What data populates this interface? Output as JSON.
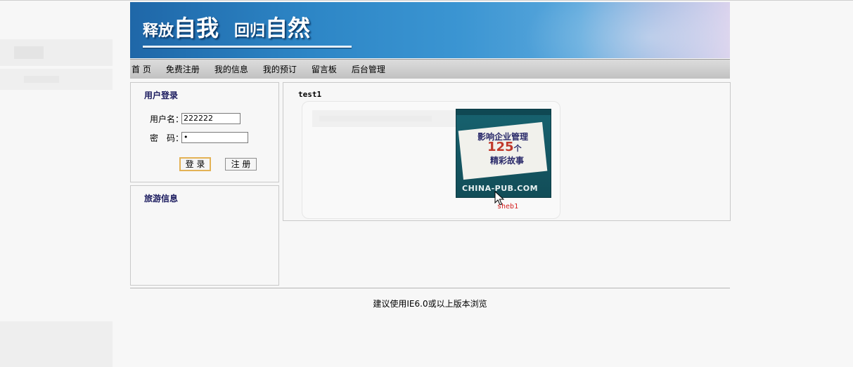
{
  "banner": {
    "title_part1_small": "释放",
    "title_part1_big": "自我",
    "title_part2_small": "回归",
    "title_part2_big": "自然"
  },
  "nav": {
    "items": [
      {
        "label": "首 页"
      },
      {
        "label": "免费注册"
      },
      {
        "label": "我的信息"
      },
      {
        "label": "我的预订"
      },
      {
        "label": "留言板"
      },
      {
        "label": "后台管理"
      }
    ]
  },
  "login": {
    "title": "用户登录",
    "username_label": "用户名：",
    "username_value": "222222",
    "password_label": "密　码：",
    "password_value": "•",
    "login_button": "登 录",
    "register_button": "注 册"
  },
  "travel": {
    "title": "旅游信息"
  },
  "main": {
    "item_name": "test1",
    "book_cover": {
      "line1": "影响企业管理",
      "line2": "125",
      "line2_suffix": "个",
      "line3": "精彩故事",
      "logo": "CHINA-PUB.COM"
    },
    "caption": "sheb1"
  },
  "footer": {
    "text": "建议使用IE6.0或以上版本浏览"
  }
}
